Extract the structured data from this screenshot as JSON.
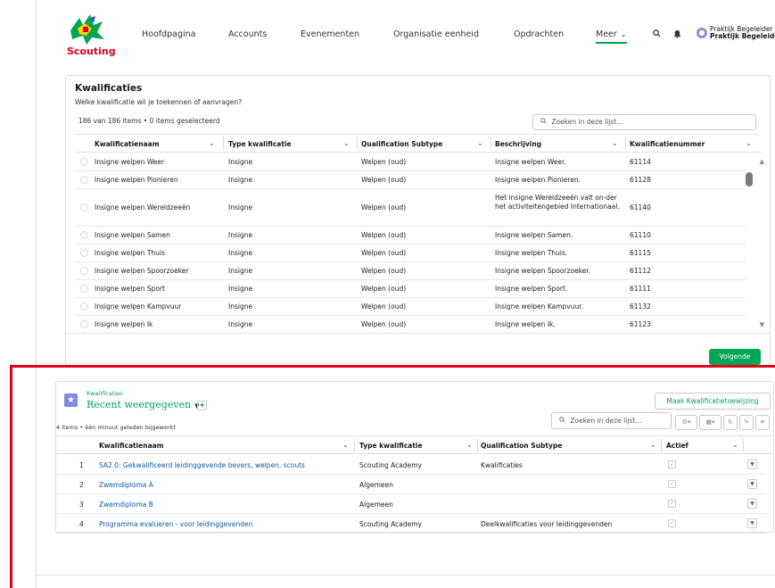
{
  "header": {
    "logo_text": "Scouting",
    "nav": [
      "Hoofdpagina",
      "Accounts",
      "Evenementen",
      "Organisatie eenheid",
      "Opdrachten",
      "Meer"
    ],
    "user_line1": "Praktijk Begeleider",
    "user_line2": "Praktijk Begeleider"
  },
  "kwalificaties": {
    "title": "Kwalificaties",
    "subtitle": "Welke kwalificatie wil je toekennen of aanvragen?",
    "count": "186 van 186 items • 0 items geselecteerd",
    "search_placeholder": "Zoeken in deze lijst...",
    "columns": [
      "Kwalificatienaam",
      "Type kwalificatie",
      "Qualification Subtype",
      "Beschrijving",
      "Kwalificatienummer"
    ],
    "rows": [
      {
        "name": "Insigne welpen Weer",
        "type": "Insigne",
        "subtype": "Welpen (oud)",
        "desc": "Insigne welpen Weer.",
        "nr": "61114"
      },
      {
        "name": "Insigne welpen Pionieren",
        "type": "Insigne",
        "subtype": "Welpen (oud)",
        "desc": "Insigne welpen Pionieren.",
        "nr": "61128"
      },
      {
        "name": "Insigne welpen Wereldzeeën",
        "type": "Insigne",
        "subtype": "Welpen (oud)",
        "desc": "Het insigne Wereldzeeën valt on-der het activiteitengebied Internationaal.",
        "nr": "61140"
      },
      {
        "name": "Insigne welpen Samen",
        "type": "Insigne",
        "subtype": "Welpen (oud)",
        "desc": "Insigne welpen Samen.",
        "nr": "61110"
      },
      {
        "name": "Insigne welpen Thuis",
        "type": "Insigne",
        "subtype": "Welpen (oud)",
        "desc": "Insigne welpen Thuis.",
        "nr": "61115"
      },
      {
        "name": "Insigne welpen Spoorzoeker",
        "type": "Insigne",
        "subtype": "Welpen (oud)",
        "desc": "Insigne welpen Spoorzoeker.",
        "nr": "61112"
      },
      {
        "name": "Insigne welpen Sport",
        "type": "Insigne",
        "subtype": "Welpen (oud)",
        "desc": "Insigne welpen Sport.",
        "nr": "61111"
      },
      {
        "name": "Insigne welpen Kampvuur",
        "type": "Insigne",
        "subtype": "Welpen (oud)",
        "desc": "Insigne welpen Kampvuur.",
        "nr": "61132"
      },
      {
        "name": "Insigne welpen Ik",
        "type": "Insigne",
        "subtype": "Welpen (oud)",
        "desc": "Insigne welpen Ik.",
        "nr": "61123"
      }
    ],
    "next_label": "Volgende"
  },
  "related": {
    "object_label": "Kwalificaties",
    "view_title": "Recent weergegeven",
    "meta": "4 items • één minuut geleden bijgewerkt",
    "new_button": "Maak Kwalificatietoewijzing",
    "search_placeholder": "Zoeken in deze lijst...",
    "columns": [
      "Kwalificatienaam",
      "Type kwalificatie",
      "Qualification Subtype",
      "Actief"
    ],
    "rows": [
      {
        "num": "1",
        "name": "SA2.0: Gekwalificeerd leidinggevende bevers, welpen, scouts",
        "type": "Scouting Academy",
        "subtype": "Kwalificaties"
      },
      {
        "num": "2",
        "name": "Zwemdiploma A",
        "type": "Algemeen",
        "subtype": ""
      },
      {
        "num": "3",
        "name": "Zwemdiploma B",
        "type": "Algemeen",
        "subtype": ""
      },
      {
        "num": "4",
        "name": "Programma evalueren - voor leidinggevenden",
        "type": "Scouting Academy",
        "subtype": "Deelkwalificaties voor leidinggevenden"
      }
    ]
  },
  "colors": {
    "accent": "#00a651",
    "highlight": "#e2001a",
    "link": "#0a5aa8"
  }
}
